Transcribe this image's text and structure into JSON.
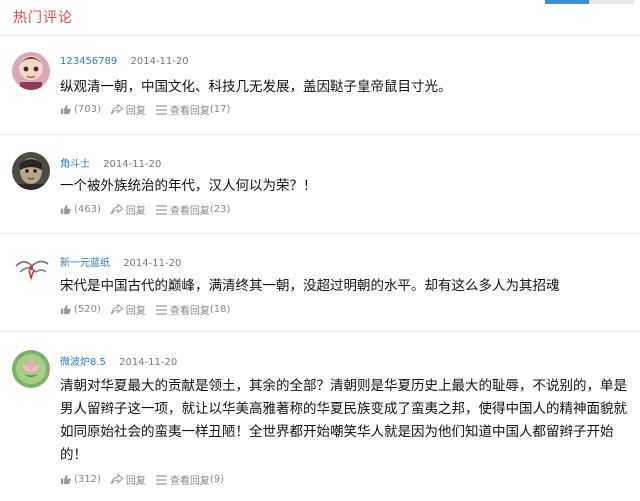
{
  "section_title": "热门评论",
  "comments": [
    {
      "user": "123456789",
      "date": "2014-11-20",
      "text": "纵观清一朝，中国文化、科技几无发展，盖因鞑子皇帝鼠目寸光。",
      "likes": "(703)",
      "reply_label": "回复",
      "view_replies_label": "查看回复",
      "reply_count": "(17)"
    },
    {
      "user": "角斗士",
      "date": "2014-11-20",
      "text": "一个被外族统治的年代，汉人何以为荣？！",
      "likes": "(463)",
      "reply_label": "回复",
      "view_replies_label": "查看回复",
      "reply_count": "(23)"
    },
    {
      "user": "新一元蓝纸",
      "date": "2014-11-20",
      "text": "宋代是中国古代的巅峰，满清终其一朝，没超过明朝的水平。却有这么多人为其招魂",
      "likes": "(520)",
      "reply_label": "回复",
      "view_replies_label": "查看回复",
      "reply_count": "(18)"
    },
    {
      "user": "微波炉8.5",
      "date": "2014-11-20",
      "text": "清朝对华夏最大的贡献是领土，其余的全部？清朝则是华夏历史上最大的耻辱，不说别的，单是男人留辫子这一项，就让以华美高雅著称的华夏民族变成了蛮夷之邦，使得中国人的精神面貌就如同原始社会的蛮夷一样丑陋！全世界都开始嘲笑华人就是因为他们知道中国人都留辫子开始的！",
      "likes": "(312)",
      "reply_label": "回复",
      "view_replies_label": "查看回复",
      "reply_count": "(9)"
    }
  ]
}
